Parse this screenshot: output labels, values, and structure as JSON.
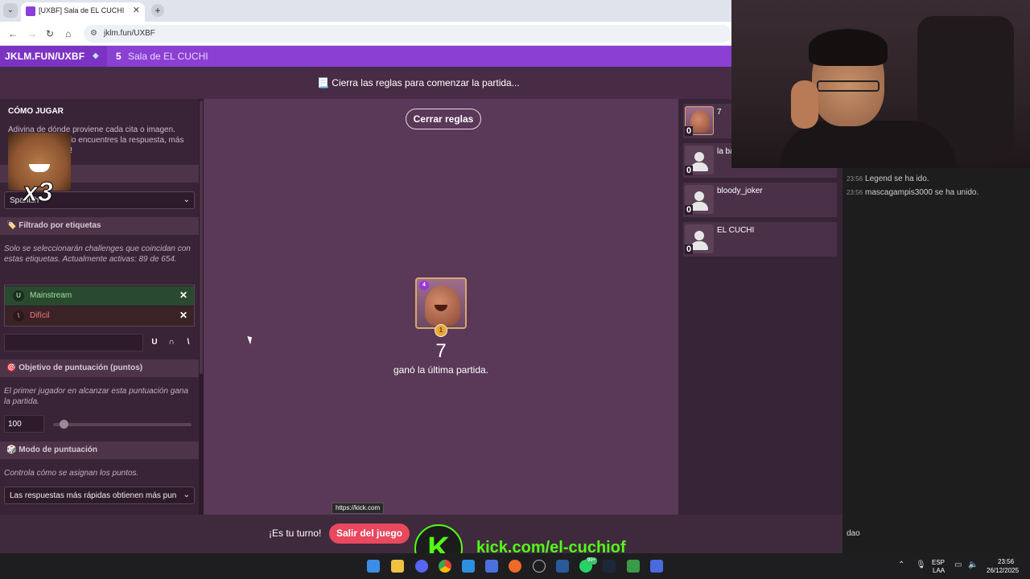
{
  "browser": {
    "tab_title": "[UXBF] Sala de EL CUCHI",
    "tab_close": "✕",
    "new_tab": "+",
    "url": "jklm.fun/UXBF"
  },
  "site": {
    "logo": "JKLM.FUN/UXBF",
    "room_count": "5",
    "room_name": "Sala de EL CUCHI"
  },
  "status_message": "📃 Cierra las reglas para comenzar la partida...",
  "sidebar": {
    "title": "CÓMO JUGAR",
    "desc": "Adivina de dónde proviene cada cita o imagen. Cuanto más rápido encuentres la respuesta, más puntos obtendrás!",
    "language_value": "Spanish",
    "tags_section": "🏷️ Filtrado por etiquetas",
    "tags_desc": "Solo se seleccionarán challenges que coincidan con estas etiquetas. Actualmente activas: 89 de 654.",
    "tags": [
      {
        "badge": "U",
        "label": "Mainstream"
      },
      {
        "badge": "\\",
        "label": "Difícil"
      }
    ],
    "tag_ops": [
      "U",
      "∩",
      "\\"
    ],
    "score_section": "🎯 Objetivo de puntuación (puntos)",
    "score_desc": "El primer jugador en alcanzar esta puntuación gana la partida.",
    "score_value": "100",
    "score_slider_fraction": 0.05,
    "mode_section": "🎲 Modo de puntuación",
    "mode_desc": "Controla cómo se asignan los puntos.",
    "mode_value": "Las respuestas más rápidas obtienen más pun"
  },
  "meme_text": "x3",
  "main": {
    "close_rules": "Cerrar reglas",
    "winner_level": "4",
    "winner_rank": "1",
    "winner_name": "7",
    "winner_msg": "ganó la última partida.",
    "tooltip": "https://kick.com"
  },
  "players": [
    {
      "name": "7",
      "score": "0",
      "avatar": "clash"
    },
    {
      "name": "la ba",
      "score": "0",
      "avatar": "default"
    },
    {
      "name": "bloody_joker",
      "score": "0",
      "avatar": "default"
    },
    {
      "name": "EL CUCHI",
      "score": "0",
      "avatar": "default"
    }
  ],
  "chat": {
    "lines": [
      {
        "time": "23:56",
        "text": "Legend se ha ido."
      },
      {
        "time": "23:56",
        "text": "mascagampis3000 se ha unido."
      }
    ],
    "input": "dao"
  },
  "bottom": {
    "your_turn": "¡Es tu turno!",
    "leave": "Salir del juego",
    "kick_letter": "K",
    "kick_url": "kick.com/el-cuchiof"
  },
  "taskbar": {
    "lang": "ESP",
    "lang2": "LAA",
    "time": "23:56",
    "date": "26/12/2025",
    "badge": "99+"
  }
}
